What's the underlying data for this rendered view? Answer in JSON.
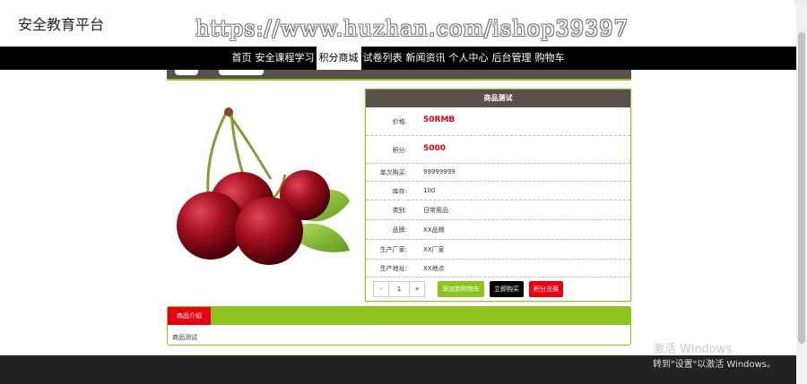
{
  "header": {
    "site_title": "安全教育平台",
    "watermark": "https://www.huzhan.com/ishop39397"
  },
  "nav": {
    "items": [
      {
        "label": "首页",
        "active": false
      },
      {
        "label": "安全课程学习",
        "active": false
      },
      {
        "label": "积分商城",
        "active": true
      },
      {
        "label": "试卷列表",
        "active": false
      },
      {
        "label": "新闻资讯",
        "active": false
      },
      {
        "label": "个人中心",
        "active": false
      },
      {
        "label": "后台管理",
        "active": false
      },
      {
        "label": "购物车",
        "active": false
      }
    ]
  },
  "product": {
    "name": "商品测试",
    "image": "cherry-image",
    "fields": {
      "price": {
        "label": "价格:",
        "value": "50RMB"
      },
      "points": {
        "label": "积分:",
        "value": "5000"
      },
      "limit": {
        "label": "单次购买:",
        "value": "99999999"
      },
      "stock": {
        "label": "库存:",
        "value": "100"
      },
      "category": {
        "label": "类别:",
        "value": "日常用品"
      },
      "brand": {
        "label": "品牌:",
        "value": "XX品牌"
      },
      "maker": {
        "label": "生产厂家:",
        "value": "XX厂家"
      },
      "origin": {
        "label": "生产地址:",
        "value": "XX地点"
      }
    },
    "quantity": {
      "minus": "-",
      "value": "1",
      "plus": "+"
    },
    "buttons": {
      "add_cart": "添加到购物车",
      "buy_now": "立即购买",
      "points_exchange": "积分兑换"
    }
  },
  "details": {
    "tab_label": "商品介绍",
    "content": "商品测试"
  },
  "windows": {
    "activate_title": "激活 Windows",
    "activate_sub": "转到\"设置\"以激活 Windows。"
  },
  "colors": {
    "accent_green": "#8dc21f",
    "brown": "#5a4f4a",
    "red": "#e60012",
    "nav_bg": "#000000"
  }
}
